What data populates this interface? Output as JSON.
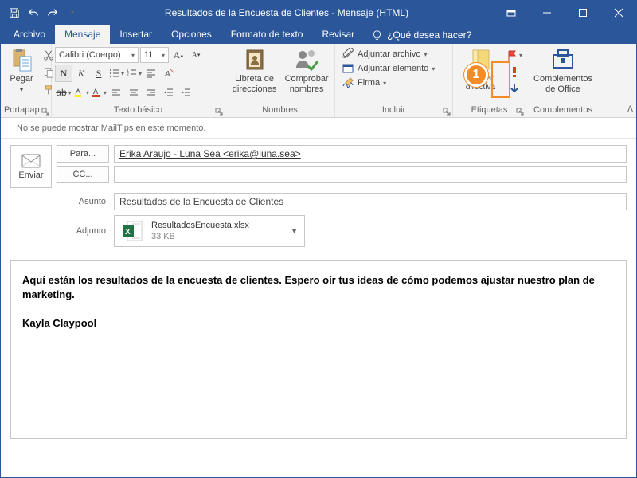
{
  "title": "Resultados de la Encuesta de Clientes  -  Mensaje (HTML)",
  "tabs": {
    "file": "Archivo",
    "message": "Mensaje",
    "insert": "Insertar",
    "options": "Opciones",
    "format": "Formato de texto",
    "review": "Revisar",
    "tellme": "¿Qué desea hacer?"
  },
  "ribbon": {
    "clipboard": {
      "paste": "Pegar",
      "label": "Portapap…"
    },
    "font": {
      "name": "Calibri (Cuerpo)",
      "size": "11",
      "label": "Texto básico"
    },
    "names": {
      "addressbook": "Libreta de direcciones",
      "check": "Comprobar nombres",
      "label": "Nombres"
    },
    "include": {
      "attachFile": "Adjuntar archivo",
      "attachItem": "Adjuntar elemento",
      "signature": "Firma",
      "label": "Incluir"
    },
    "tags": {
      "policy": "Asignar directiva",
      "label": "Etiquetas"
    },
    "addins": {
      "btn": "Complementos de Office",
      "label": "Complementos"
    }
  },
  "mailtips": "No se puede mostrar MailTips en este momento.",
  "compose": {
    "send": "Enviar",
    "to": "Para...",
    "cc": "CC...",
    "subject_lbl": "Asunto",
    "attach_lbl": "Adjunto",
    "to_val": "Erika Araujo - Luna Sea <erika@luna.sea>",
    "cc_val": "",
    "subject_val": "Resultados de la Encuesta de Clientes",
    "attachment": {
      "name": "ResultadosEncuesta.xlsx",
      "size": "33 KB"
    }
  },
  "body": {
    "p1": "Aquí están los resultados de la encuesta de clientes. Espero oír tus ideas de cómo podemos ajustar nuestro plan de marketing.",
    "sig": "Kayla Claypool"
  },
  "marker": "1"
}
